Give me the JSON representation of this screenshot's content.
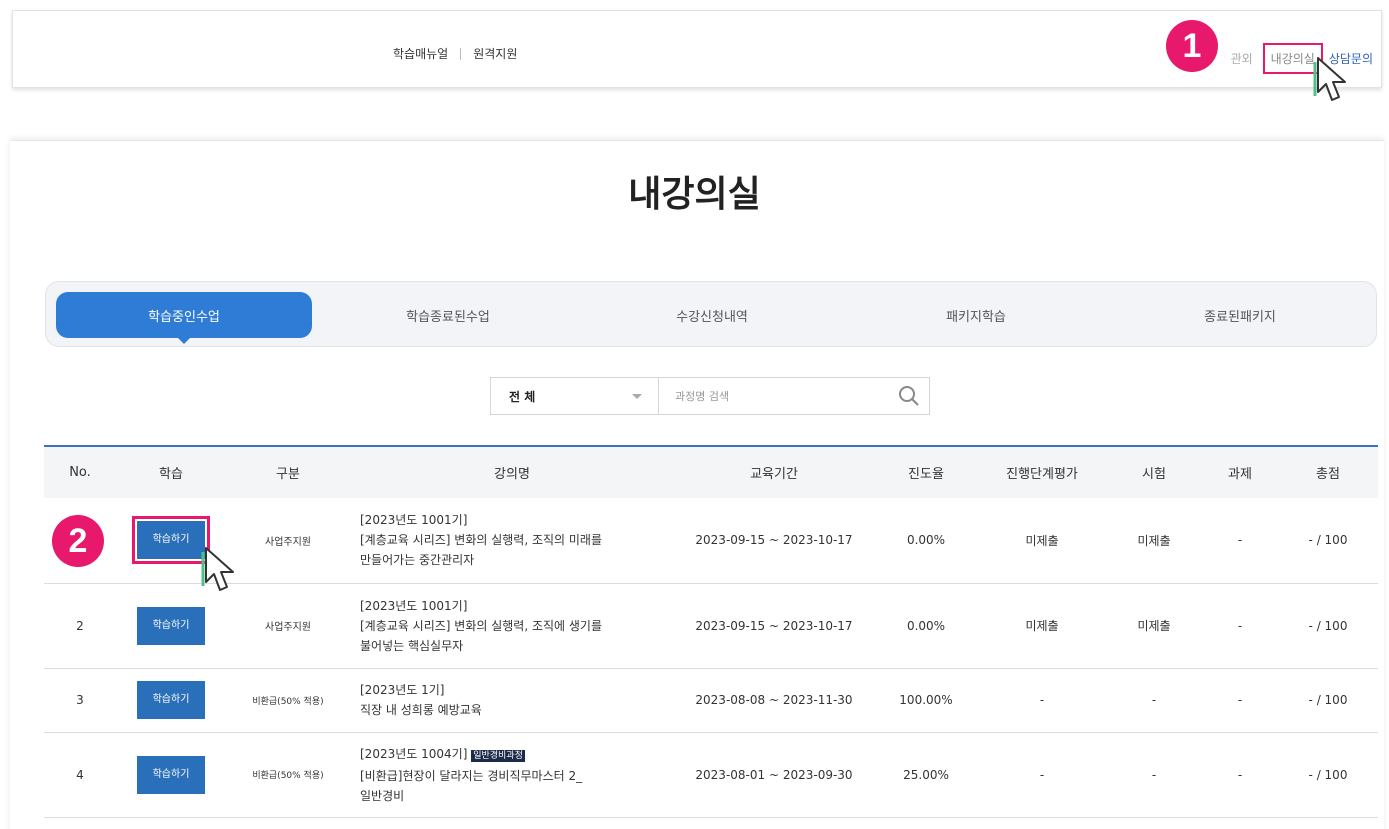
{
  "header": {
    "nav": [
      "학습매뉴얼",
      "원격지원"
    ],
    "right_partial": "관외",
    "my_class": "내강의실",
    "consult": "상담문의"
  },
  "markers": {
    "step1": "1",
    "step2": "2"
  },
  "page_title": "내강의실",
  "tabs": [
    "학습중인수업",
    "학습종료된수업",
    "수강신청내역",
    "패키지학습",
    "종료된패키지"
  ],
  "search": {
    "select_value": "전 체",
    "placeholder": "과정명 검색"
  },
  "table": {
    "headers": [
      "No.",
      "학습",
      "구분",
      "강의명",
      "교육기간",
      "진도율",
      "진행단계평가",
      "시험",
      "과제",
      "총점"
    ],
    "rows": [
      {
        "no": "",
        "button": "학습하기",
        "type": "사업주지원",
        "title_line1": "[2023년도 1001기]",
        "title_line2": "[계층교육 시리즈] 변화의 실행력, 조직의 미래를",
        "title_line3": "만들어가는 중간관리자",
        "tag": "",
        "period": "2023-09-15 ~ 2023-10-17",
        "progress": "0.00%",
        "eval": "미제출",
        "exam": "미제출",
        "task": "-",
        "score": "- / 100"
      },
      {
        "no": "2",
        "button": "학습하기",
        "type": "사업주지원",
        "title_line1": "[2023년도 1001기]",
        "title_line2": "[계층교육 시리즈] 변화의 실행력, 조직에 생기를",
        "title_line3": "불어넣는 핵심실무자",
        "tag": "",
        "period": "2023-09-15 ~ 2023-10-17",
        "progress": "0.00%",
        "eval": "미제출",
        "exam": "미제출",
        "task": "-",
        "score": "- / 100"
      },
      {
        "no": "3",
        "button": "학습하기",
        "type": "비환급(50% 적용)",
        "title_line1": "[2023년도 1기]",
        "title_line2": "직장 내 성희롱 예방교육",
        "title_line3": "",
        "tag": "",
        "period": "2023-08-08 ~ 2023-11-30",
        "progress": "100.00%",
        "eval": "-",
        "exam": "-",
        "task": "-",
        "score": "- / 100"
      },
      {
        "no": "4",
        "button": "학습하기",
        "type": "비환급(50% 적용)",
        "title_line1": "[2023년도 1004기]",
        "title_line2": "[비환급]현장이 달라지는 경비직무마스터 2_",
        "title_line3": "일반경비",
        "tag": "일반경비과정",
        "period": "2023-08-01 ~ 2023-09-30",
        "progress": "25.00%",
        "eval": "-",
        "exam": "-",
        "task": "-",
        "score": "- / 100"
      }
    ]
  },
  "colors": {
    "accent": "#2f7cd6",
    "highlight": "#e8186d",
    "button": "#2a6fba"
  }
}
